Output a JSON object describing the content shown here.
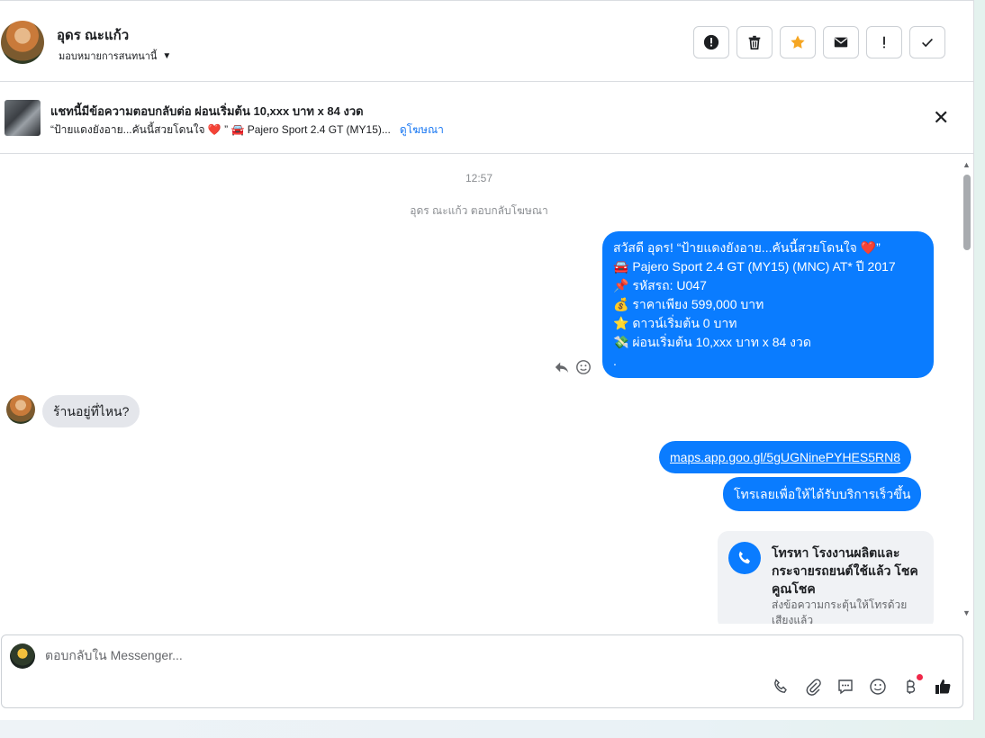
{
  "header": {
    "contact_name": "อุดร ณะแก้ว",
    "assign_label": "มอบหมายการสนทนานี้",
    "tools": [
      "alert-icon",
      "trash-icon",
      "star-icon",
      "envelope-icon",
      "exclamation-icon",
      "check-icon"
    ]
  },
  "ad": {
    "title": "แชทนี้มีข้อความตอบกลับต่อ ผ่อนเริ่มต้น 10,xxx บาท x 84 งวด",
    "subtitle": "“ป้ายแดงยังอาย...คันนี้สวยโดนใจ ❤️ ” 🚘 Pajero Sport 2.4 GT (MY15)...",
    "link": "ดูโฆษณา"
  },
  "chat": {
    "timestamp": "12:57",
    "reply_note": "อุดร ณะแก้ว ตอบกลับโฆษณา",
    "outgoing_1": [
      "สวัสดี อุดร! “ป้ายแดงยังอาย...คันนี้สวยโดนใจ ❤️”",
      "🚘 Pajero Sport 2.4 GT (MY15) (MNC) AT* ปี 2017",
      "📌 รหัสรถ: U047",
      "💰 ราคาเพียง 599,000 บาท",
      "⭐ ดาวน์เริ่มต้น 0 บาท",
      "💸 ผ่อนเริ่มต้น 10,xxx บาท x 84 งวด",
      "."
    ],
    "incoming_1": "ร้านอยู่ที่ไหน?",
    "outgoing_2": "maps.app.goo.gl/5gUGNinePYHES5RN8",
    "outgoing_3": "โทรเลยเพื่อให้ได้รับบริการเร็วขึ้น",
    "call_card": {
      "title": "โทรหา โรงงานผลิตและกระจายรถยนต์ใช้แล้ว โชคคูณโชค",
      "desc": "ส่งข้อความกระตุ้นให้โทรด้วยเสียงแล้ว"
    }
  },
  "composer": {
    "placeholder": "ตอบกลับใน Messenger..."
  },
  "colors": {
    "accent": "#0a7cff",
    "incoming_bubble": "#e4e6eb",
    "notification_dot": "#f02849"
  }
}
